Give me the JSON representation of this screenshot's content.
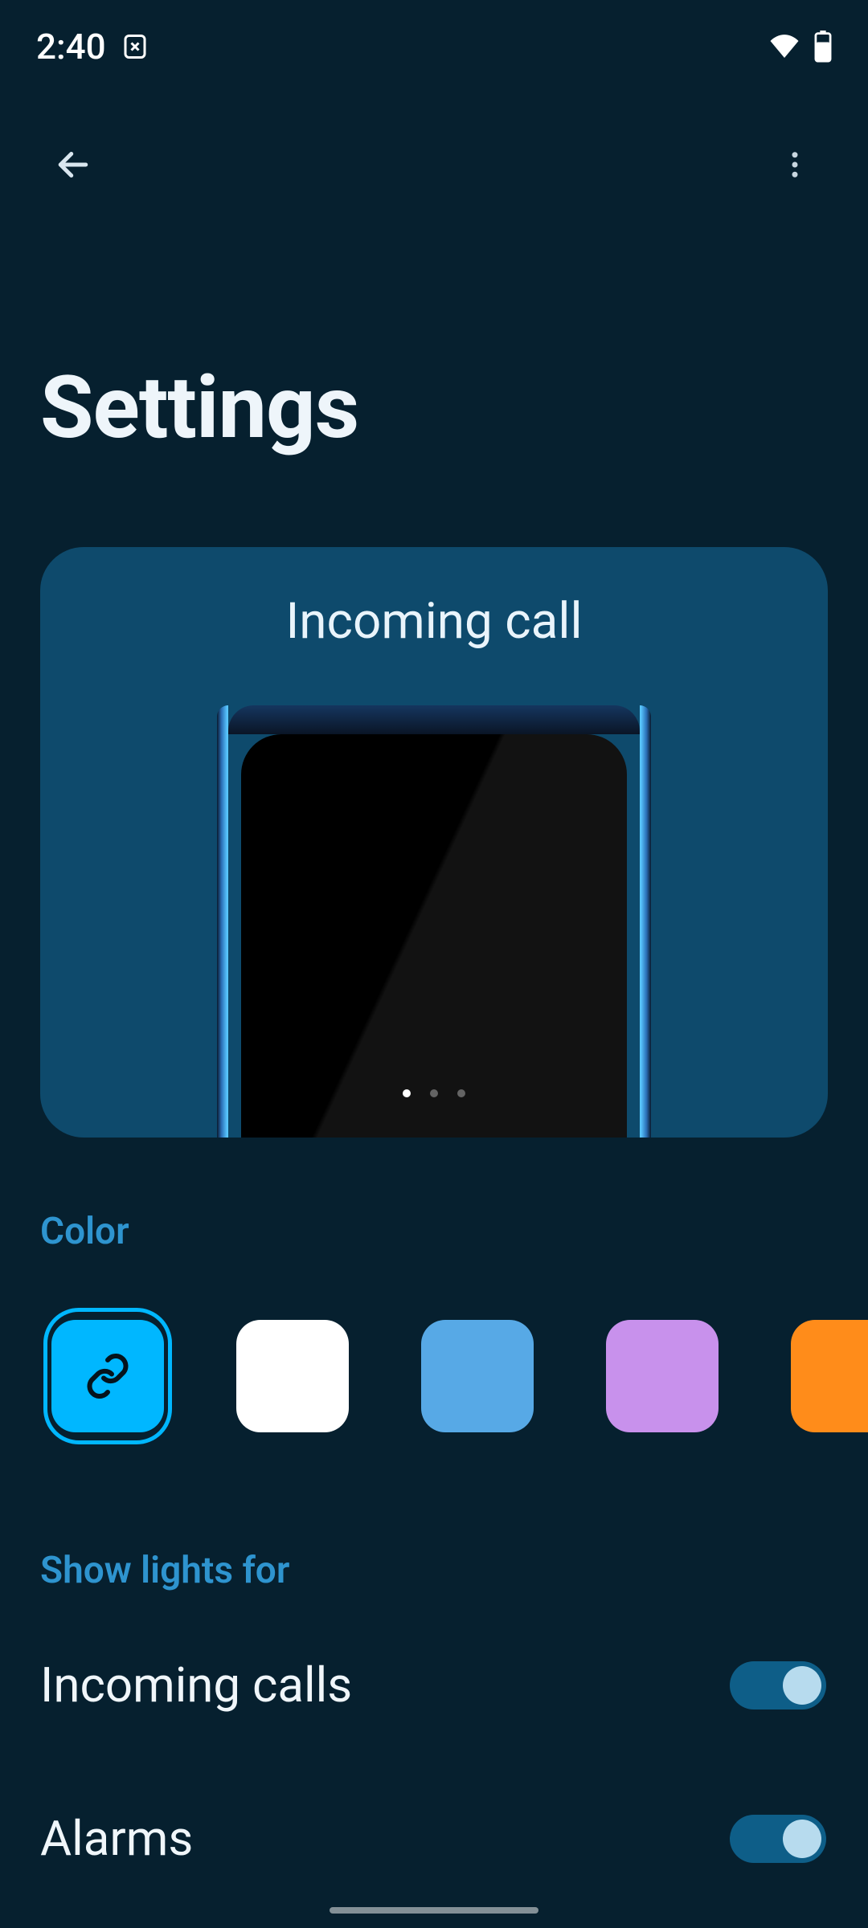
{
  "status_bar": {
    "time": "2:40",
    "icons": {
      "near_clock_icon": "battery-saver-x-icon",
      "wifi_icon": "wifi-icon",
      "battery_icon": "battery-icon"
    }
  },
  "app_bar": {
    "back_icon": "back-arrow-icon",
    "more_icon": "more-vert-icon"
  },
  "page": {
    "title": "Settings"
  },
  "preview": {
    "title": "Incoming call",
    "page_count": 3,
    "active_page": 0
  },
  "section_color": {
    "label": "Color",
    "swatches": [
      {
        "name": "linked",
        "color": "#00b7ff",
        "selected": true,
        "has_link_icon": true
      },
      {
        "name": "white",
        "color": "#ffffff",
        "selected": false,
        "has_link_icon": false
      },
      {
        "name": "blue",
        "color": "#57a9e6",
        "selected": false,
        "has_link_icon": false
      },
      {
        "name": "purple",
        "color": "#c891ec",
        "selected": false,
        "has_link_icon": false
      },
      {
        "name": "orange",
        "color": "#ff8c1a",
        "selected": false,
        "has_link_icon": false
      }
    ]
  },
  "section_lights": {
    "label": "Show lights for",
    "items": [
      {
        "label": "Incoming calls",
        "value": true
      },
      {
        "label": "Alarms",
        "value": true
      }
    ]
  },
  "colors": {
    "bg": "#06202f",
    "card_bg": "#0e4a6c",
    "accent": "#00b7ff",
    "section_heading": "#2e94cf",
    "switch_track_on": "#0e5e88",
    "switch_knob_on": "#b7dbee"
  }
}
